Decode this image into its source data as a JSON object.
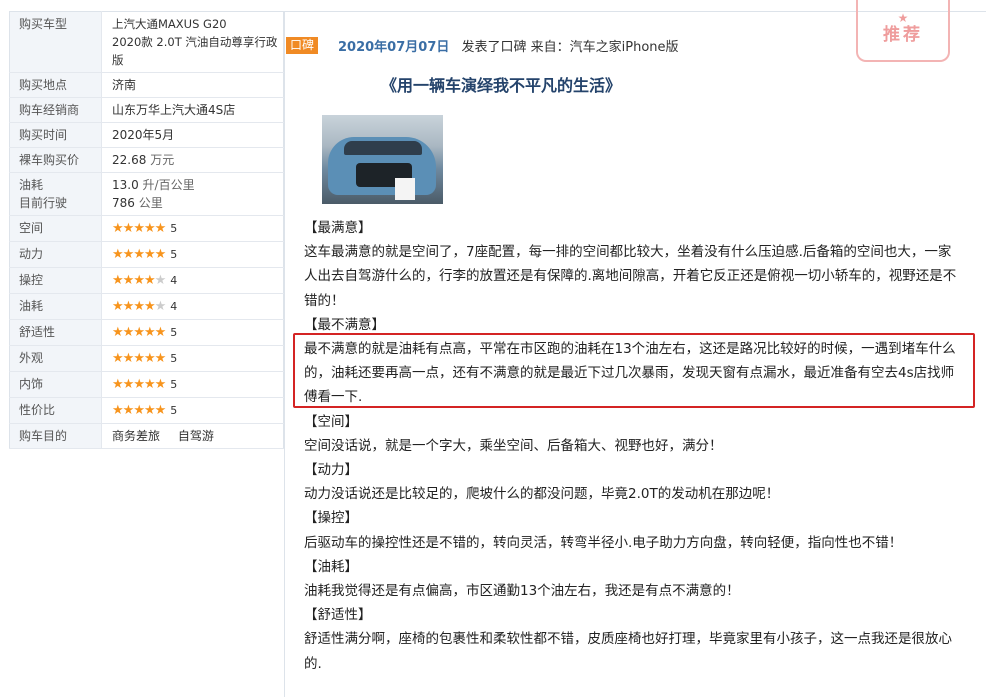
{
  "info": {
    "model_label": "购买车型",
    "model_line1": "上汽大通MAXUS G20",
    "model_line2": "2020款 2.0T 汽油自动尊享行政",
    "model_line3": "版",
    "location_label": "购买地点",
    "location": "济南",
    "dealer_label": "购车经销商",
    "dealer": "山东万华上汽大通4S店",
    "time_label": "购买时间",
    "time": "2020年5月",
    "price_label": "裸车购买价",
    "price_value": "22.68",
    "price_unit": "万元",
    "fuel_label_1": "油耗",
    "fuel_label_2": "目前行驶",
    "fuel_value": "13.0",
    "fuel_unit": "升/百公里",
    "mileage_value": "786",
    "mileage_unit": "公里",
    "ratings": [
      {
        "label": "空间",
        "score": "5",
        "stars": 5
      },
      {
        "label": "动力",
        "score": "5",
        "stars": 5
      },
      {
        "label": "操控",
        "score": "4",
        "stars": 4
      },
      {
        "label": "油耗",
        "score": "4",
        "stars": 4
      },
      {
        "label": "舒适性",
        "score": "5",
        "stars": 5
      },
      {
        "label": "外观",
        "score": "5",
        "stars": 5
      },
      {
        "label": "内饰",
        "score": "5",
        "stars": 5
      },
      {
        "label": "性价比",
        "score": "5",
        "stars": 5
      }
    ],
    "purpose_label": "购车目的",
    "purposes": [
      "商务差旅",
      "自驾游"
    ]
  },
  "post": {
    "tag": "口碑",
    "date": "2020年07月07日",
    "meta": "发表了口碑 来自：汽车之家iPhone版",
    "stamp": "推荐",
    "stamp_star": "★",
    "title": "《用一辆车演绎我不平凡的生活》"
  },
  "colors": {
    "star": "#f7941d",
    "highlight_border": "#d42424",
    "tag_bg": "#f08a24"
  },
  "sections": [
    {
      "h": "【最满意】",
      "t": "这车最满意的就是空间了，7座配置，每一排的空间都比较大，坐着没有什么压迫感.后备箱的空间也大，一家人出去自驾游什么的，行李的放置还是有保障的.离地间隙高，开着它反正还是俯视一切小轿车的，视野还是不错的！"
    },
    {
      "h": "【最不满意】",
      "t": "最不满意的就是油耗有点高，平常在市区跑的油耗在13个油左右，这还是路况比较好的时候，一遇到堵车什么的，油耗还要再高一点，还有不满意的就是最近下过几次暴雨，发现天窗有点漏水，最近准备有空去4s店找师傅看一下."
    },
    {
      "h": "【空间】",
      "t": "空间没话说，就是一个字大，乘坐空间、后备箱大、视野也好，满分！"
    },
    {
      "h": "【动力】",
      "t": "动力没话说还是比较足的，爬坡什么的都没问题，毕竟2.0T的发动机在那边呢！"
    },
    {
      "h": "【操控】",
      "t": "后驱动车的操控性还是不错的，转向灵活，转弯半径小.电子助力方向盘，转向轻便，指向性也不错！"
    },
    {
      "h": "【油耗】",
      "t": "油耗我觉得还是有点偏高，市区通勤13个油左右，我还是有点不满意的！"
    },
    {
      "h": "【舒适性】",
      "t": "舒适性满分啊，座椅的包裹性和柔软性都不错，皮质座椅也好打理，毕竟家里有小孩子，这一点我还是很放心的."
    }
  ]
}
